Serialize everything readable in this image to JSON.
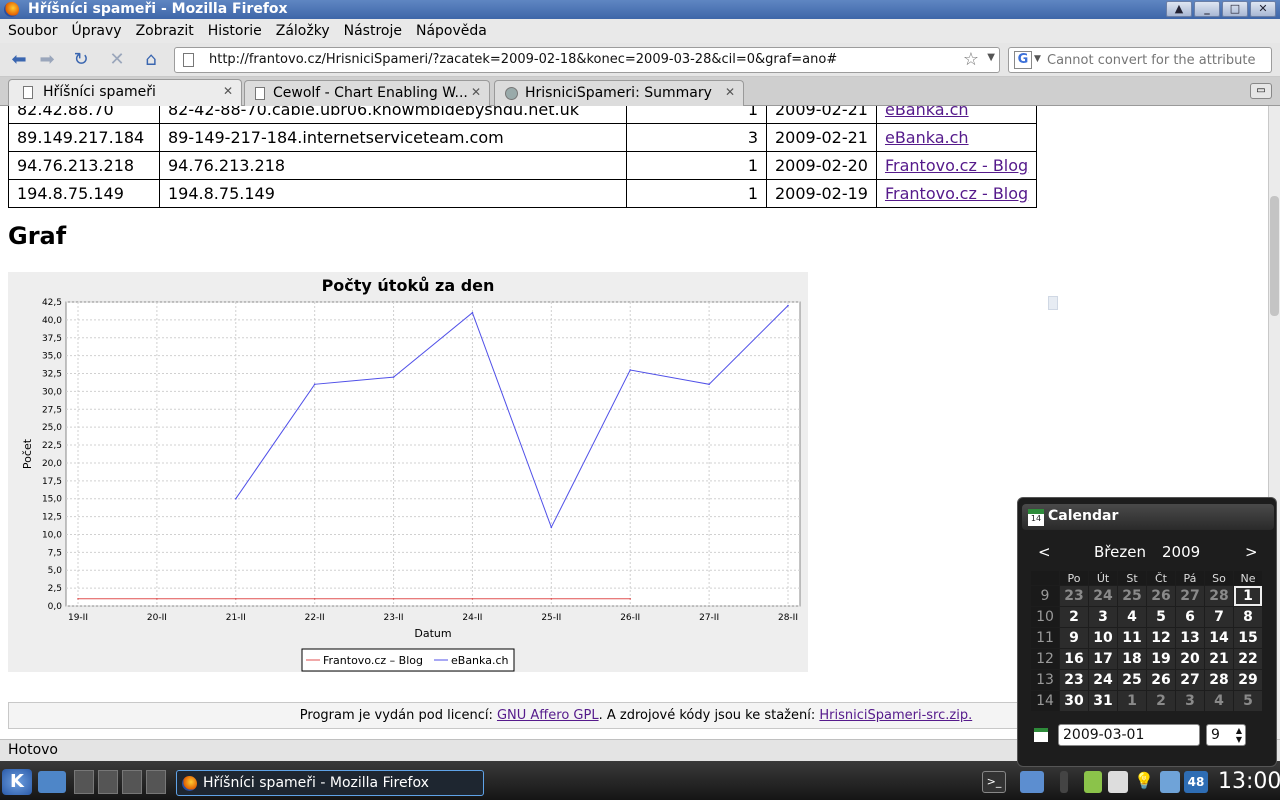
{
  "window": {
    "title": "Hříšníci spameři - Mozilla Firefox"
  },
  "menu": [
    "Soubor",
    "Úpravy",
    "Zobrazit",
    "Historie",
    "Záložky",
    "Nástroje",
    "Nápověda"
  ],
  "nav": {
    "url": "http://frantovo.cz/HrisniciSpameri/?zacatek=2009-02-18&konec=2009-03-28&cil=0&graf=ano#",
    "search_placeholder": "Cannot convert for the attribute"
  },
  "tabs": [
    {
      "label": "Hříšníci spameři"
    },
    {
      "label": "Cewolf - Chart Enabling W..."
    },
    {
      "label": "HrisniciSpameri: Summary"
    }
  ],
  "table": {
    "rows": [
      {
        "ip": "82.42.88.70",
        "host": "82-42-88-70.cable.ubr06.knowmbidebyshdu.net.uk",
        "count": "1",
        "date": "2009-02-21",
        "target": "eBanka.ch"
      },
      {
        "ip": "89.149.217.184",
        "host": "89-149-217-184.internetserviceteam.com",
        "count": "3",
        "date": "2009-02-21",
        "target": "eBanka.ch"
      },
      {
        "ip": "94.76.213.218",
        "host": "94.76.213.218",
        "count": "1",
        "date": "2009-02-20",
        "target": "Frantovo.cz - Blog"
      },
      {
        "ip": "194.8.75.149",
        "host": "194.8.75.149",
        "count": "1",
        "date": "2009-02-19",
        "target": "Frantovo.cz - Blog"
      }
    ]
  },
  "graf_heading": "Graf",
  "chart_data": {
    "type": "line",
    "title": "Počty útoků za den",
    "xlabel": "Datum",
    "ylabel": "Počet",
    "categories": [
      "19-II",
      "20-II",
      "21-II",
      "22-II",
      "23-II",
      "24-II",
      "25-II",
      "26-II",
      "27-II",
      "28-II"
    ],
    "ylim": [
      0,
      42.5
    ],
    "yticks": [
      "0,0",
      "2,5",
      "5,0",
      "7,5",
      "10,0",
      "12,5",
      "15,0",
      "17,5",
      "20,0",
      "22,5",
      "25,0",
      "27,5",
      "30,0",
      "32,5",
      "35,0",
      "37,5",
      "40,0",
      "42,5"
    ],
    "grid": true,
    "legend_position": "bottom",
    "series": [
      {
        "name": "Frantovo.cz – Blog",
        "color": "#e05050",
        "values": [
          1,
          1,
          1,
          1,
          1,
          1,
          1,
          1,
          null,
          null
        ]
      },
      {
        "name": "eBanka.ch",
        "color": "#5050e8",
        "values": [
          null,
          null,
          15,
          31,
          32,
          41,
          11,
          33,
          31,
          42
        ]
      }
    ]
  },
  "footer": {
    "text1": "Program je vydán pod licencí: ",
    "link1": "GNU Affero GPL",
    "text2": ". A zdrojové kódy jsou ke stažení: ",
    "link2": "HrisniciSpameri-src.zip."
  },
  "status": "Hotovo",
  "taskbar": {
    "task_label": "Hříšníci spameři - Mozilla Firefox",
    "clock": "13:00",
    "tray_badge": "48"
  },
  "calendar": {
    "title": "Calendar",
    "month": "Březen",
    "year": "2009",
    "prev": "<",
    "next": ">",
    "weekdays": [
      "Po",
      "Út",
      "St",
      "Čt",
      "Pá",
      "So",
      "Ne"
    ],
    "weeks": [
      {
        "wk": "9",
        "days": [
          "23",
          "24",
          "25",
          "26",
          "27",
          "28",
          "1"
        ]
      },
      {
        "wk": "10",
        "days": [
          "2",
          "3",
          "4",
          "5",
          "6",
          "7",
          "8"
        ]
      },
      {
        "wk": "11",
        "days": [
          "9",
          "10",
          "11",
          "12",
          "13",
          "14",
          "15"
        ]
      },
      {
        "wk": "12",
        "days": [
          "16",
          "17",
          "18",
          "19",
          "20",
          "21",
          "22"
        ]
      },
      {
        "wk": "13",
        "days": [
          "23",
          "24",
          "25",
          "26",
          "27",
          "28",
          "29"
        ]
      },
      {
        "wk": "14",
        "days": [
          "30",
          "31",
          "1",
          "2",
          "3",
          "4",
          "5"
        ]
      }
    ],
    "date_value": "2009-03-01",
    "week_value": "9"
  }
}
